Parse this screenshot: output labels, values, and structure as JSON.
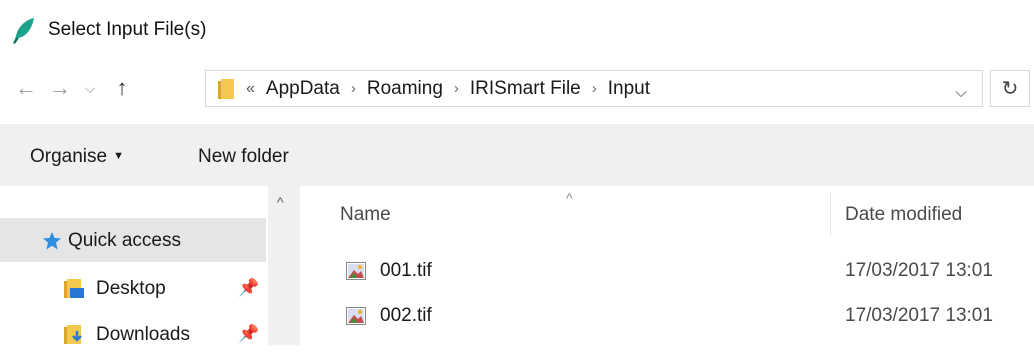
{
  "window": {
    "title": "Select Input File(s)"
  },
  "nav": {
    "back_glyph": "←",
    "forward_glyph": "→",
    "recent_glyph": "⌵",
    "up_glyph": "↑",
    "overflow_glyph": "«",
    "breadcrumbs": [
      "AppData",
      "Roaming",
      "IRISmart File",
      "Input"
    ],
    "separator": "›",
    "dropdown_glyph": "⌵",
    "refresh_glyph": "↻"
  },
  "toolbar": {
    "organise_label": "Organise",
    "organise_caret": "▼",
    "new_folder_label": "New folder"
  },
  "sidebar": {
    "scroll_up_glyph": "^",
    "pin_glyph": "📌",
    "items": [
      {
        "label": "Quick access",
        "icon": "star-icon",
        "pinned": false
      },
      {
        "label": "Desktop",
        "icon": "desktop-folder-icon",
        "pinned": true
      },
      {
        "label": "Downloads",
        "icon": "downloads-folder-icon",
        "pinned": true
      }
    ]
  },
  "filelist": {
    "sort_glyph": "^",
    "columns": {
      "name": "Name",
      "date": "Date modified"
    },
    "files": [
      {
        "name": "001.tif",
        "date": "17/03/2017 13:01",
        "icon": "tif-image-icon"
      },
      {
        "name": "002.tif",
        "date": "17/03/2017 13:01",
        "icon": "tif-image-icon"
      }
    ]
  },
  "colors": {
    "toolbar_bg": "#f0f0f0",
    "selected_bg": "#e5e5e5",
    "folder_yellow": "#f2c94c",
    "accent_blue": "#1e88e5",
    "title_icon_teal": "#1aa38a"
  }
}
